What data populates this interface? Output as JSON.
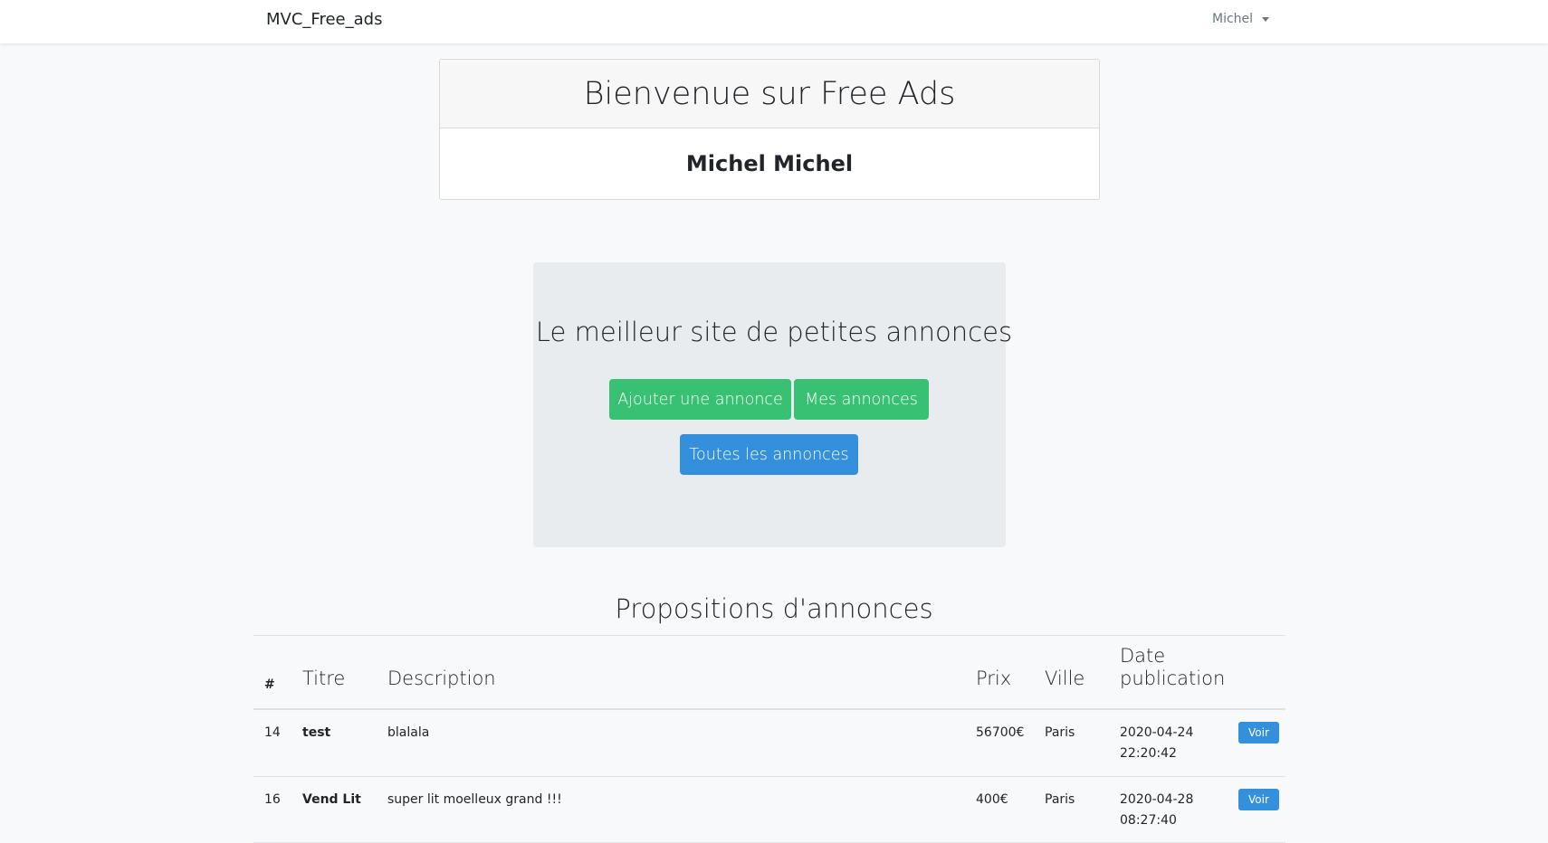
{
  "navbar": {
    "brand": "MVC_Free_ads",
    "user": "Michel"
  },
  "welcome": {
    "title": "Bienvenue sur Free Ads",
    "user_name": "Michel Michel"
  },
  "jumbotron": {
    "title": "Le meilleur site de petites annonces",
    "add_button": "Ajouter une annonce",
    "mine_button": "Mes annonces",
    "all_button": "Toutes les annonces"
  },
  "colors": {
    "green": "#38c172",
    "blue": "#3490dc",
    "jumbotron_bg": "#e9ecef"
  },
  "proposals": {
    "title": "Propositions d'annonces",
    "headers": [
      "#",
      "Titre",
      "Description",
      "Prix",
      "Ville",
      "Date publication",
      ""
    ],
    "rows": [
      {
        "id": "14",
        "title": "test",
        "description": "blalala",
        "price": "56700€",
        "city": "Paris",
        "date": "2020-04-24",
        "time": "22:20:42",
        "action": "Voir"
      },
      {
        "id": "16",
        "title": "Vend Lit",
        "description": "super lit moelleux grand !!!",
        "price": "400€",
        "city": "Paris",
        "date": "2020-04-28",
        "time": "08:27:40",
        "action": "Voir"
      }
    ]
  }
}
